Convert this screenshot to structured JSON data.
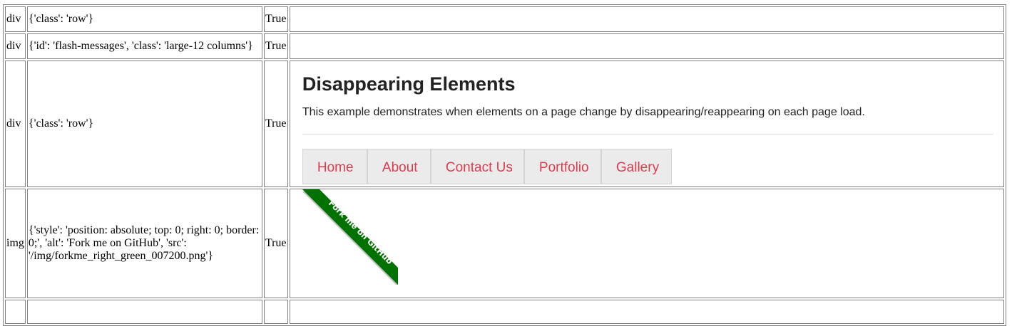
{
  "rows": [
    {
      "tag": "div",
      "attrs": "{'class': 'row'}",
      "visible": "True"
    },
    {
      "tag": "div",
      "attrs": "{'id': 'flash-messages', 'class': 'large-12 columns'}",
      "visible": "True"
    },
    {
      "tag": "div",
      "attrs": "{'class': 'row'}",
      "visible": "True"
    },
    {
      "tag": "img",
      "attrs": "{'style': 'position: absolute; top: 0; right: 0; border: 0;', 'alt': 'Fork me on GitHub', 'src': '/img/forkme_right_green_007200.png'}",
      "visible": "True"
    }
  ],
  "render": {
    "heading": "Disappearing Elements",
    "description": "This example demonstrates when elements on a page change by disappearing/reappearing on each page load.",
    "nav": [
      {
        "label": "Home"
      },
      {
        "label": "About"
      },
      {
        "label": "Contact Us"
      },
      {
        "label": "Portfolio"
      },
      {
        "label": "Gallery"
      }
    ],
    "ribbon": {
      "text": "Fork me on GitHub",
      "color": "#007200"
    }
  },
  "colors": {
    "link": "#dd3c4f",
    "nav_bg": "#ebebeb",
    "ribbon_green": "#007200"
  }
}
